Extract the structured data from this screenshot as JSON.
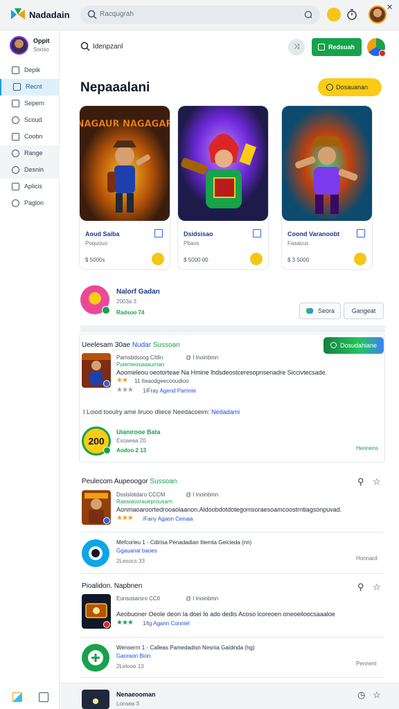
{
  "app": {
    "title": "Nadadain"
  },
  "top_search": {
    "placeholder": "Racqugrah"
  },
  "colors": {
    "accent_green": "#16a34a",
    "accent_yellow": "#facc15",
    "accent_blue": "#1d9bf0",
    "link_blue": "#1d4ed8"
  },
  "sidebar": {
    "user": {
      "name": "Oppit",
      "sub": "Sooso"
    },
    "items": [
      {
        "label": "Depik",
        "icon": "calendar-icon"
      },
      {
        "label": "Recnt",
        "icon": "square-icon"
      },
      {
        "label": "Sepern",
        "icon": "doc-icon"
      },
      {
        "label": "Scoud",
        "icon": "compass-icon"
      },
      {
        "label": "Coobn",
        "icon": "box-icon"
      },
      {
        "label": "Range",
        "icon": "clock-icon"
      },
      {
        "label": "Desnin",
        "icon": "circle-icon"
      },
      {
        "label": "Aplicis",
        "icon": "grid-icon"
      },
      {
        "label": "Paglon",
        "icon": "help-icon"
      }
    ]
  },
  "main": {
    "search_text": "Idenpzanl",
    "green_button": "Redsuah",
    "section_title": "Nepaaalani",
    "yellow_button": "Dosauanan"
  },
  "cards": [
    {
      "art_text": "NAGAUR NAGAGAR",
      "title": "Aoud Saiba",
      "sub": "Poquouo",
      "price": "$ 5000s"
    },
    {
      "art_text": "",
      "title": "Dsidsisao",
      "sub": "Pbaos",
      "price": "$ 5000 00"
    },
    {
      "art_text": "",
      "title": "Coond Varanoobt",
      "sub": "Fasacus",
      "price": "$ 3 5000"
    }
  ],
  "featured": {
    "name": "Nalorf Gadan",
    "sub": "2003a 3",
    "rating": "Radsoo 74",
    "btn1": "Seora",
    "btn2": "Gangeat"
  },
  "review_panel": {
    "heading_prefix": "Ueelesam 30ae",
    "heading_link": "Nudar",
    "heading_green": "Sussoan",
    "button": "Dosudahiane",
    "review": {
      "meta": "Pamsbdsoog  CItiln",
      "meta_right": "@ I lnoinbmn",
      "tag": "Puiemeosaaaurnan",
      "body_line": "Aoomeleou oeotorteae Na Hmine lhdsdeostceresopnsenadre Siccivtecsade.",
      "line2": "11 Iteaodgeecooudioo",
      "by": "1/Fray",
      "by_link": "Agend Pamnie",
      "stars": 2
    },
    "note": "I Loiod tooulry ame liruoo dliece Needacoeim:",
    "note_link": "Nedadami",
    "app": {
      "score": "200",
      "name": "Uianirooe Bata",
      "meta": "Esoaeaa 20",
      "rating": "Aodoo 2 13",
      "right": "Hennens"
    }
  },
  "section2": {
    "heading": "Peulecom Aupeoogor",
    "heading_green": "Sussoan",
    "review": {
      "meta": "Dsslslotdaro  CCCM",
      "meta_right": "@ I lnoinbmn",
      "tag": "Raesiaosraueprousarn",
      "body_line": "Aonmaoaroortedrooaolaanon.Aldoobdotdotegomsoraesoamcoostrntiagsonpuvad.",
      "by": "/Fany",
      "by_link": "Agaon Cenaia",
      "stars": 3
    },
    "app": {
      "title": "Mefcorieu 1 -  Cdirisa  Penadadian  Itiemta  Geicieda  (nn)",
      "link": "Ggauanal baoes",
      "meta": "2Lesocs 33",
      "right": "Honnard"
    }
  },
  "section3": {
    "heading": "Pioalidon. Napbnen",
    "review": {
      "meta": "Eunsosarsro  CCtI",
      "meta_right": "@ I lnoinbmn",
      "tag": "",
      "body_line": "Aeobuoner  Oeole deon Ia doei Io ado dedis Acoso lcoreoen  oneoeiloocsaaaloe",
      "by": "1/tg",
      "by_link": "Agann Conniel",
      "stars": 3
    },
    "app": {
      "title": "Wenserrn 1 -  Calleas  Pamedadisn  Nesnia  Gaidinda  (hg)",
      "link": "Gaoraon Bion",
      "meta": "2Lelooo 13",
      "right": "Pennenl"
    }
  },
  "bottom": {
    "name": "Nenaeooman",
    "sub": "Lonsea 3"
  }
}
